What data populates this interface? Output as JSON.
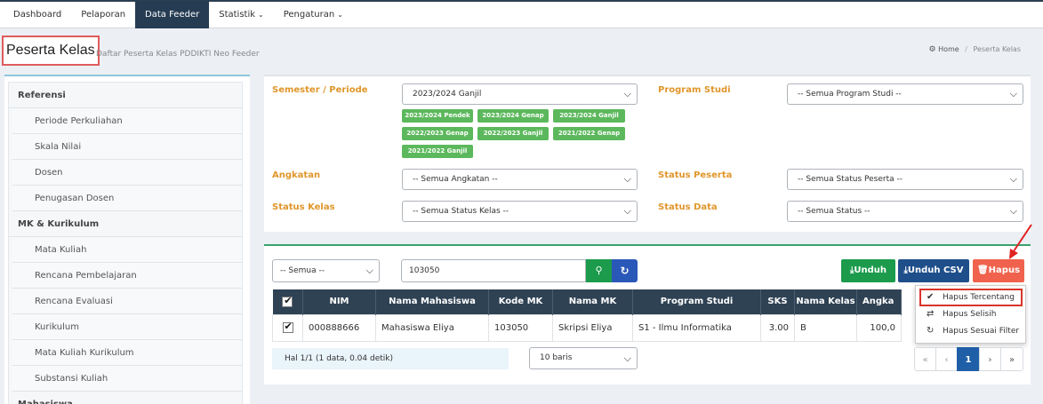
{
  "nav": {
    "items": [
      "Dashboard",
      "Pelaporan",
      "Data Feeder",
      "Statistik",
      "Pengaturan"
    ],
    "caret": "⌄"
  },
  "page": {
    "title": "Peserta Kelas",
    "subtitle": "Daftar Peserta Kelas PDDIKTI Neo Feeder",
    "breadcrumb_home": "Home",
    "breadcrumb_current": "Peserta Kelas"
  },
  "sidebar": {
    "groups": [
      {
        "title": "Referensi",
        "items": [
          "Periode Perkuliahan",
          "Skala Nilai",
          "Dosen",
          "Penugasan Dosen"
        ]
      },
      {
        "title": "MK & Kurikulum",
        "items": [
          "Mata Kuliah",
          "Rencana Pembelajaran",
          "Rencana Evaluasi",
          "Kurikulum",
          "Mata Kuliah Kurikulum",
          "Substansi Kuliah"
        ]
      },
      {
        "title": "Mahasiswa",
        "items": []
      }
    ]
  },
  "filters": {
    "semester_label": "Semester / Periode",
    "semester_value": "2023/2024 Ganjil",
    "semester_chips": [
      "2023/2024 Pendek",
      "2023/2024 Genap",
      "2023/2024 Ganjil",
      "2022/2023 Genap",
      "2022/2023 Ganjil",
      "2021/2022 Genap",
      "2021/2022 Ganjil"
    ],
    "prodi_label": "Program Studi",
    "prodi_value": "-- Semua Program Studi --",
    "angkatan_label": "Angkatan",
    "angkatan_value": "-- Semua Angkatan --",
    "status_peserta_label": "Status Peserta",
    "status_peserta_value": "-- Semua Status Peserta --",
    "status_kelas_label": "Status Kelas",
    "status_kelas_value": "-- Semua Status Kelas --",
    "status_data_label": "Status Data",
    "status_data_value": "-- Semua Status --"
  },
  "toolbar": {
    "scope_value": "-- Semua --",
    "search_value": "103050",
    "unduh": "Unduh",
    "unduh_csv": "Unduh CSV",
    "hapus": "Hapus"
  },
  "dropdown": {
    "items": [
      "Hapus Tercentang",
      "Hapus Selisih",
      "Hapus Sesuai Filter"
    ]
  },
  "table": {
    "columns": [
      "NIM",
      "Nama Mahasiswa",
      "Kode MK",
      "Nama MK",
      "Program Studi",
      "SKS",
      "Nama Kelas",
      "Angka"
    ],
    "rows": [
      {
        "nim": "000888666",
        "nama": "Mahasiswa Eliya",
        "kode": "103050",
        "nama_mk": "Skripsi Eliya",
        "prodi": "S1 - Ilmu Informatika",
        "sks": "3.00",
        "kelas": "B",
        "angka": "100,0"
      }
    ]
  },
  "footer": {
    "info": "Hal 1/1 (1 data, 0.04 detik)",
    "per_page": "10 baris",
    "pages": [
      "«",
      "‹",
      "1",
      "›",
      "»"
    ]
  },
  "colors": {
    "accent": "#263c53",
    "chip": "#5cb85c",
    "label": "#e0962a",
    "danger": "#f0624d",
    "success": "#1c9b4c",
    "primary": "#1f4f8a"
  }
}
